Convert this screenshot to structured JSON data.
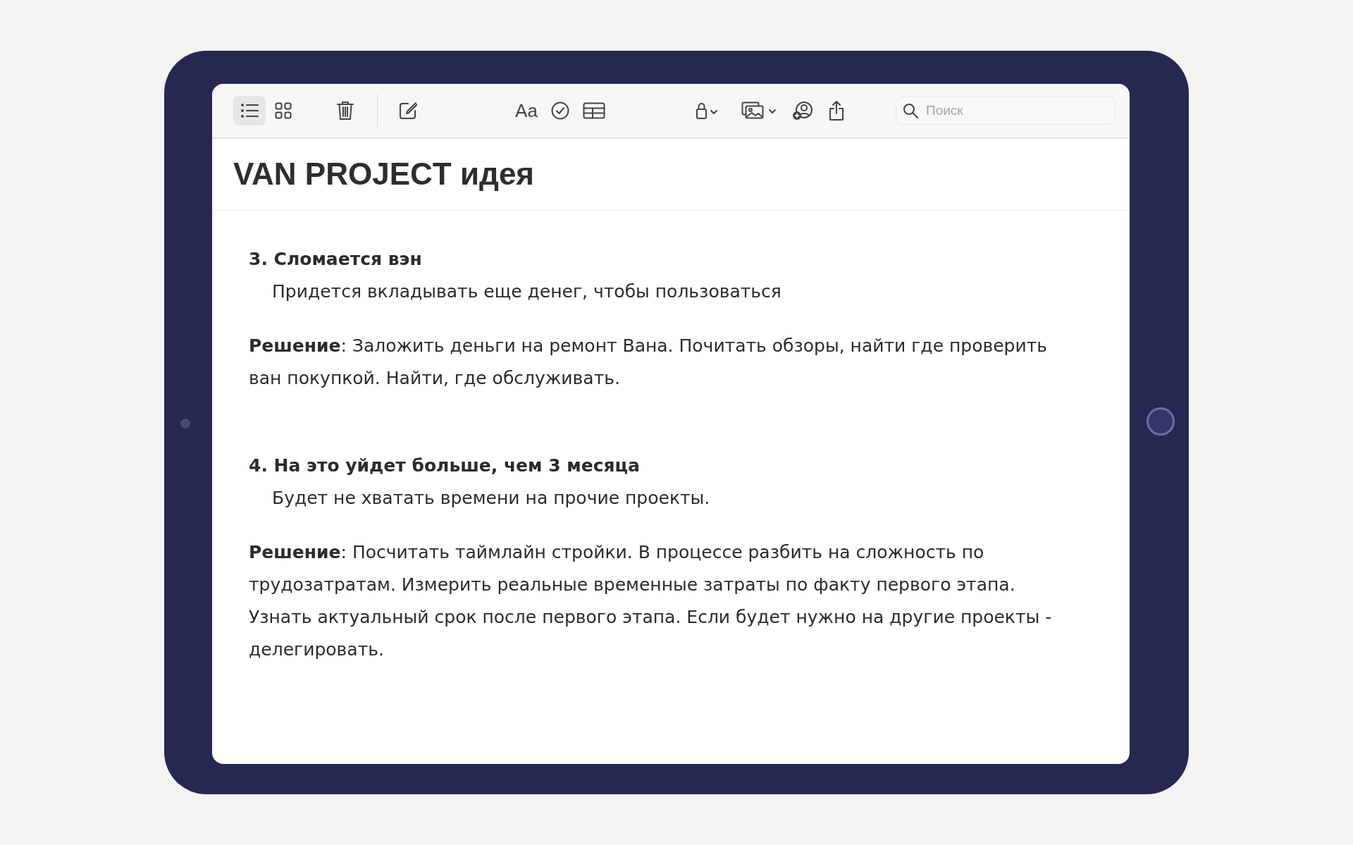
{
  "toolbar": {
    "view_buttons": [
      {
        "kind": "list",
        "selected": true
      },
      {
        "kind": "gallery",
        "selected": false
      }
    ],
    "format_label": "Aa",
    "search": {
      "placeholder": "Поиск"
    }
  },
  "note": {
    "title": "VAN PROJECT идея",
    "sections": [
      {
        "heading": "3. Сломается вэн",
        "detail": "Придется вкладывать еще денег, чтобы пользоваться",
        "solution": "**Решение**: Заложить деньги на ремонт Вана. Почитать обзоры, найти где проверить ван покупкой. Найти, где обслуживать."
      },
      {
        "heading": "4. На это уйдет больше, чем 3 месяца",
        "detail": "Будет не хватать времени на прочие проекты.",
        "solution": "**Решение**: Посчитать таймлайн стройки. В процессе разбить на сложность по трудозатратам. Измерить реальные временные затраты по факту первого этапа. Узнать актуальный срок после первого этапа. Если будет нужно на другие проекты - делегировать."
      }
    ]
  }
}
